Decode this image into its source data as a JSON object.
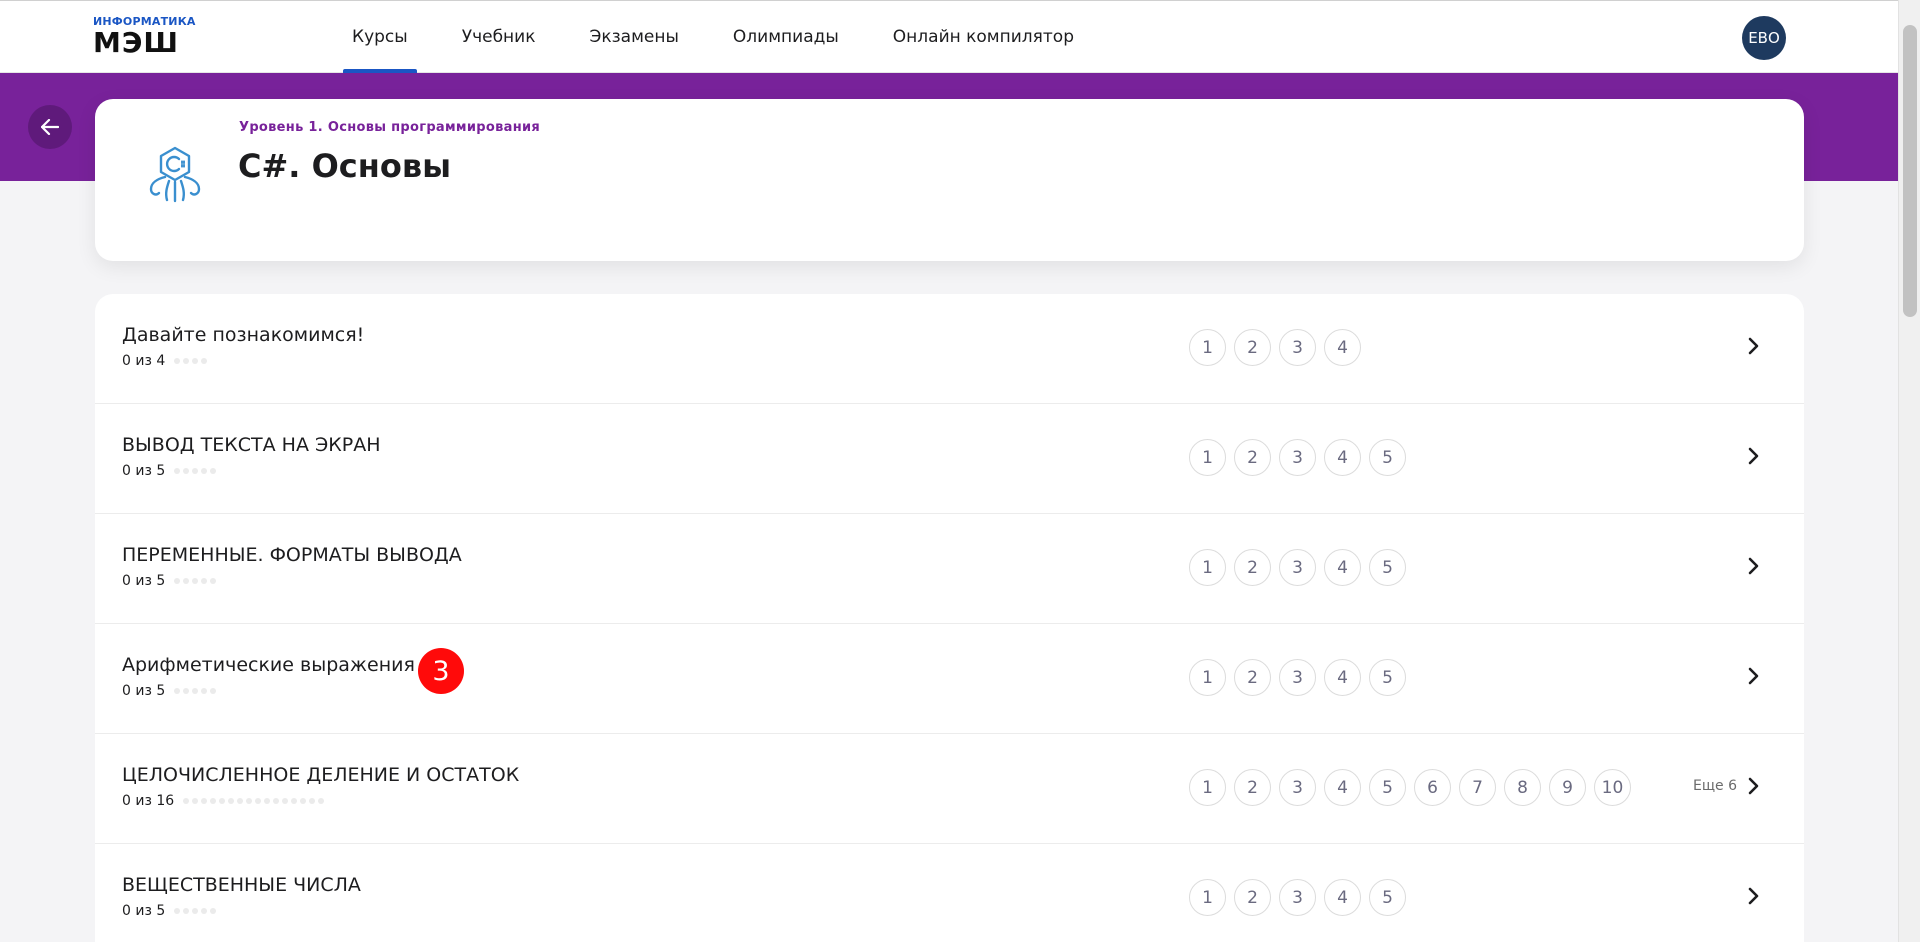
{
  "header": {
    "logo_small": "ИНФОРМАТИКА",
    "logo_big": "МЭШ",
    "nav": [
      {
        "label": "Курсы",
        "active": true
      },
      {
        "label": "Учебник",
        "active": false
      },
      {
        "label": "Экзамены",
        "active": false
      },
      {
        "label": "Олимпиады",
        "active": false
      },
      {
        "label": "Онлайн компилятор",
        "active": false
      }
    ],
    "avatar_initials": "ЕВО"
  },
  "course": {
    "level": "Уровень 1. Основы программирования",
    "title": "C#. Основы",
    "icon": "csharp-course-icon"
  },
  "lessons": [
    {
      "title": "Давайте познакомимся!",
      "progress": "0 из 4",
      "total": 4,
      "tasks": [
        "1",
        "2",
        "3",
        "4"
      ],
      "more": ""
    },
    {
      "title": "ВЫВОД ТЕКСТА НА ЭКРАН",
      "progress": "0 из 5",
      "total": 5,
      "tasks": [
        "1",
        "2",
        "3",
        "4",
        "5"
      ],
      "more": ""
    },
    {
      "title": "ПЕРЕМЕННЫЕ. ФОРМАТЫ ВЫВОДА",
      "progress": "0 из 5",
      "total": 5,
      "tasks": [
        "1",
        "2",
        "3",
        "4",
        "5"
      ],
      "more": ""
    },
    {
      "title": "Арифметические выражения",
      "progress": "0 из 5",
      "total": 5,
      "tasks": [
        "1",
        "2",
        "3",
        "4",
        "5"
      ],
      "more": ""
    },
    {
      "title": "ЦЕЛОЧИСЛЕННОЕ ДЕЛЕНИЕ И ОСТАТОК",
      "progress": "0 из 16",
      "total": 16,
      "tasks": [
        "1",
        "2",
        "3",
        "4",
        "5",
        "6",
        "7",
        "8",
        "9",
        "10"
      ],
      "more": "Еще 6"
    },
    {
      "title": "ВЕЩЕСТВЕННЫЕ ЧИСЛА",
      "progress": "0 из 5",
      "total": 5,
      "tasks": [
        "1",
        "2",
        "3",
        "4",
        "5"
      ],
      "more": ""
    }
  ],
  "annotation_badge": "3",
  "colors": {
    "accent_purple": "#78229a",
    "accent_blue": "#1a56c4",
    "avatar_bg": "#1e3a5f",
    "badge_red": "#ff0a0a"
  }
}
